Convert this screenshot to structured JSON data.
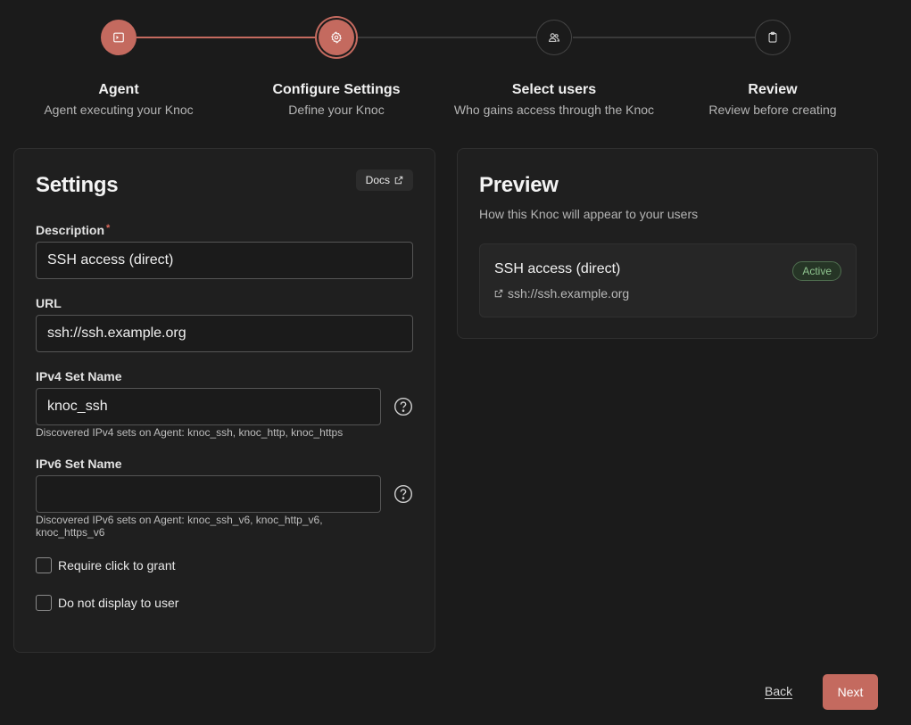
{
  "stepper": {
    "steps": [
      {
        "title": "Agent",
        "subtitle": "Agent executing your Knoc",
        "icon": "terminal-icon",
        "state": "complete"
      },
      {
        "title": "Configure Settings",
        "subtitle": "Define your Knoc",
        "icon": "gear-icon",
        "state": "current"
      },
      {
        "title": "Select users",
        "subtitle": "Who gains access through the Knoc",
        "icon": "users-icon",
        "state": "pending"
      },
      {
        "title": "Review",
        "subtitle": "Review before creating",
        "icon": "clipboard-icon",
        "state": "pending"
      }
    ]
  },
  "settings": {
    "title": "Settings",
    "docs_label": "Docs",
    "description": {
      "label": "Description",
      "required_mark": "*",
      "value": "SSH access (direct)"
    },
    "url": {
      "label": "URL",
      "value": "ssh://ssh.example.org"
    },
    "ipv4": {
      "label": "IPv4 Set Name",
      "value": "knoc_ssh",
      "hint": "Discovered IPv4 sets on Agent: knoc_ssh, knoc_http, knoc_https"
    },
    "ipv6": {
      "label": "IPv6 Set Name",
      "value": "",
      "hint": "Discovered IPv6 sets on Agent: knoc_ssh_v6, knoc_http_v6, knoc_https_v6"
    },
    "require_click": {
      "label": "Require click to grant",
      "checked": false
    },
    "hide_from_user": {
      "label": "Do not display to user",
      "checked": false
    }
  },
  "preview": {
    "title": "Preview",
    "subtitle": "How this Knoc will appear to your users",
    "item": {
      "title": "SSH access (direct)",
      "url": "ssh://ssh.example.org",
      "status": "Active"
    }
  },
  "footer": {
    "back_label": "Back",
    "next_label": "Next"
  },
  "colors": {
    "accent": "#c46a5f",
    "background": "#1b1b1b",
    "card": "#1f1f1f",
    "status_active": "#8fc48f"
  }
}
